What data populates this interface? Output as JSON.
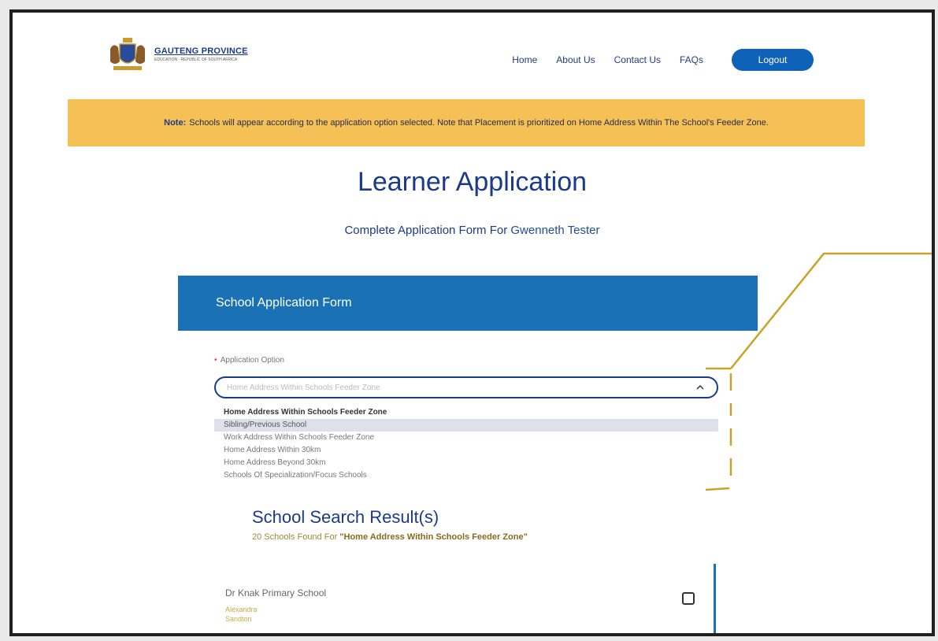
{
  "header": {
    "logo_title": "GAUTENG PROVINCE",
    "logo_sub": "EDUCATION · REPUBLIC OF SOUTH AFRICA",
    "nav": [
      {
        "label": "Home"
      },
      {
        "label": "About Us"
      },
      {
        "label": "Contact Us"
      },
      {
        "label": "FAQs"
      }
    ],
    "logout_label": "Logout"
  },
  "notice": {
    "prefix": "Note:",
    "text": "Schools will appear according to the application option selected. Note that Placement is prioritized on Home Address Within The School's Feeder Zone."
  },
  "page": {
    "title": "Learner Application",
    "subtitle_prefix": "Complete Application Form For",
    "learner_name": "Gwenneth Tester"
  },
  "form": {
    "section_title": "School Application Form",
    "field_label": "Application Option",
    "required_mark": "•",
    "placeholder": "Home Address Within Schools Feeder Zone",
    "options": [
      "Home Address Within Schools Feeder Zone",
      "Sibling/Previous School",
      "Work Address Within Schools Feeder Zone",
      "Home Address Within 30km",
      "Home Address Beyond 30km",
      "Schools Of Specialization/Focus Schools"
    ],
    "highlighted_index": 1
  },
  "results": {
    "title": "School Search Result(s)",
    "count_text": "20 Schools Found For",
    "query": "\"Home Address Within Schools Feeder Zone\"",
    "schools": [
      {
        "name": "Dr Knak Primary School",
        "area1": "Alexandra",
        "area2": "Sandton"
      }
    ]
  },
  "colors": {
    "primary": "#1a72b4",
    "navy": "#1a3a8a",
    "notice_bg": "#f5c056",
    "callout": "#c9a227"
  }
}
